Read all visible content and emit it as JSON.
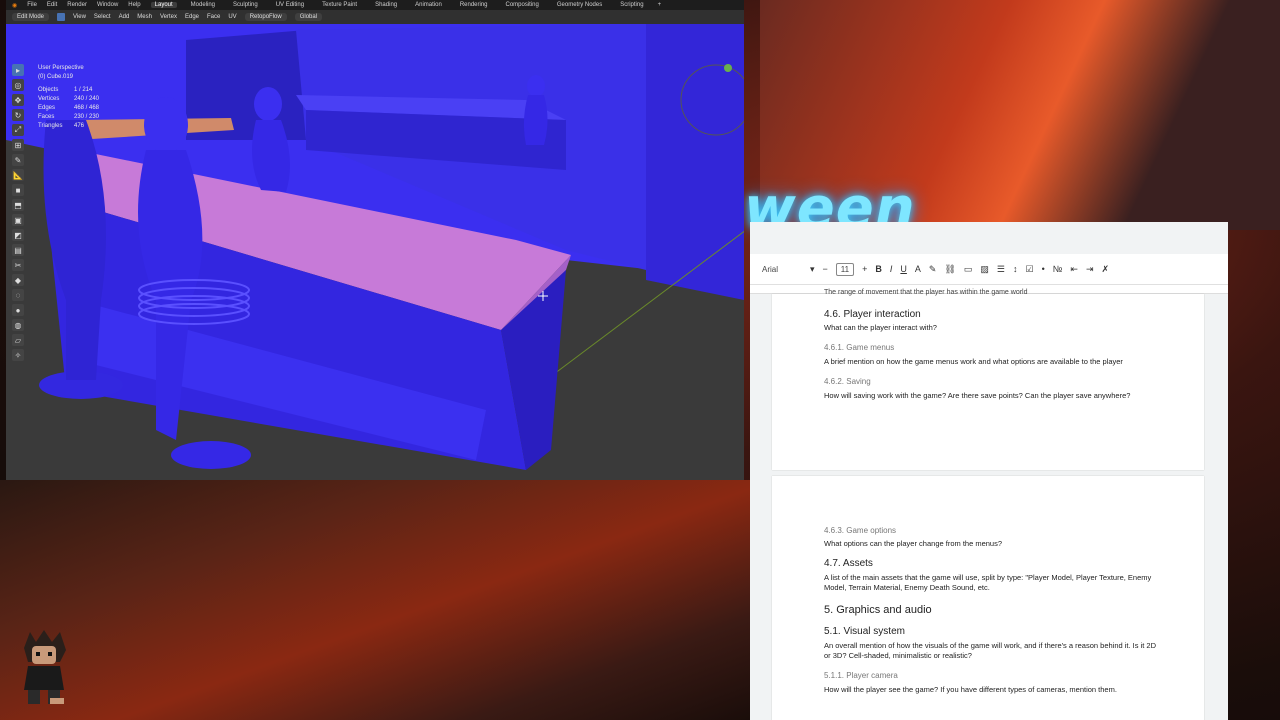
{
  "blender": {
    "menu": [
      "File",
      "Edit",
      "Render",
      "Window",
      "Help"
    ],
    "workspaces": [
      "Layout",
      "Modeling",
      "Sculpting",
      "UV Editing",
      "Texture Paint",
      "Shading",
      "Animation",
      "Rendering",
      "Compositing",
      "Geometry Nodes",
      "Scripting"
    ],
    "active_workspace": "Layout",
    "header": {
      "mode": "Edit Mode",
      "menus": [
        "View",
        "Select",
        "Add",
        "Mesh",
        "Vertex",
        "Edge",
        "Face",
        "UV"
      ],
      "addon": "RetopoFlow",
      "orientation": "Global"
    },
    "viewport": {
      "view_name": "User Perspective",
      "object_name": "(0) Cube.019",
      "stats": [
        {
          "label": "Objects",
          "value": "1 / 214"
        },
        {
          "label": "Vertices",
          "value": "240 / 240"
        },
        {
          "label": "Edges",
          "value": "468 / 468"
        },
        {
          "label": "Faces",
          "value": "230 / 230"
        },
        {
          "label": "Triangles",
          "value": "476"
        }
      ]
    }
  },
  "background": {
    "neon_text": "ween"
  },
  "gdoc": {
    "font": "Arial",
    "font_size": "11",
    "page1": {
      "cut_text": "The range of movement that the player has within the game world",
      "h_interaction": "4.6. Player interaction",
      "p_interaction": "What can the player interact with?",
      "h_menus": "4.6.1. Game menus",
      "p_menus": "A brief mention on how the game menus work and what options are available to the player",
      "h_saving": "4.6.2. Saving",
      "p_saving": "How will saving work with the game? Are there save points? Can the player save anywhere?"
    },
    "page2": {
      "h_options": "4.6.3. Game options",
      "p_options": "What options can the player change from the menus?",
      "h_assets": "4.7. Assets",
      "p_assets": "A list of the main assets that the game will use, split by type: \"Player Model, Player Texture, Enemy Model, Terrain Material, Enemy Death Sound, etc.",
      "h_graphics": "5. Graphics and audio",
      "h_visual": "5.1. Visual system",
      "p_visual": "An overall mention of how the visuals of the game will work, and if there's a reason behind it. Is it 2D or 3D? Cell-shaded, minimalistic or realistic?",
      "h_camera": "5.1.1. Player camera",
      "p_camera": "How will the player see the game? If you have different types of cameras, mention them."
    }
  },
  "colors": {
    "model_blue": "#3b2ff0",
    "selected_pink": "#c77ad8",
    "blender_accent": "#4772b3"
  }
}
